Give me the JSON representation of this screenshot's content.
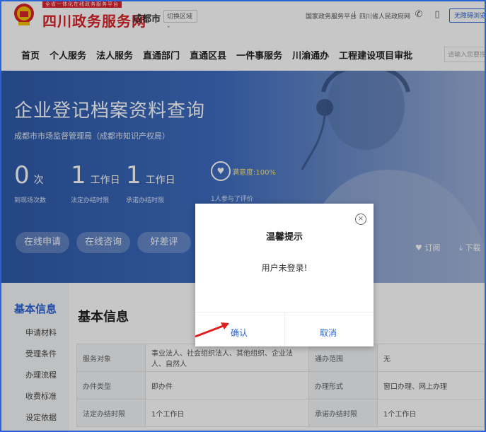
{
  "header": {
    "slogan": "全省一体化在线政务服务平台",
    "site_name": "四川政务服务网",
    "city": "成都市",
    "region_selector": "切换区域 ˅",
    "top_links": [
      "国家政务服务平台",
      "四川省人民政府网"
    ],
    "link_separator": "|",
    "care_mode": "无障碍浏览",
    "search_placeholder": "请输入您要搜"
  },
  "nav": {
    "items": [
      "首页",
      "个人服务",
      "法人服务",
      "直通部门",
      "直通区县",
      "一件事服务",
      "川渝通办",
      "工程建设项目审批"
    ]
  },
  "banner": {
    "title": "企业登记档案资料查询",
    "department": "成都市市场监督管理局（成都市知识产权局）",
    "stats": [
      {
        "num": "0",
        "unit": "次",
        "label": "到现场次数"
      },
      {
        "num": "1",
        "unit": "工作日",
        "label": "法定办结时限"
      },
      {
        "num": "1",
        "unit": "工作日",
        "label": "承诺办结时限"
      }
    ],
    "satisfaction": "满意度:100%",
    "rating_count": "1人参与了评价",
    "buttons": [
      "在线申请",
      "在线咨询",
      "好差评"
    ],
    "subscribe": "订阅",
    "download": "下载"
  },
  "left_nav": {
    "active": "基本信息",
    "items": [
      "申请材料",
      "受理条件",
      "办理流程",
      "收费标准",
      "设定依据"
    ]
  },
  "main": {
    "title": "基本信息",
    "rows": [
      [
        "服务对象",
        "事业法人、社会组织法人、其他组织、企业法人、自然人",
        "通办范围",
        "无"
      ],
      [
        "办件类型",
        "即办件",
        "办理形式",
        "窗口办理、网上办理"
      ],
      [
        "法定办结时限",
        "1个工作日",
        "承诺办结时限",
        "1个工作日"
      ]
    ]
  },
  "modal": {
    "title": "温馨提示",
    "message": "用户未登录!",
    "ok": "确认",
    "cancel": "取消",
    "close": "×"
  },
  "colors": {
    "brand_red": "#d8232a",
    "accent_blue": "#2b63d6",
    "annotation_red": "#e02020"
  }
}
